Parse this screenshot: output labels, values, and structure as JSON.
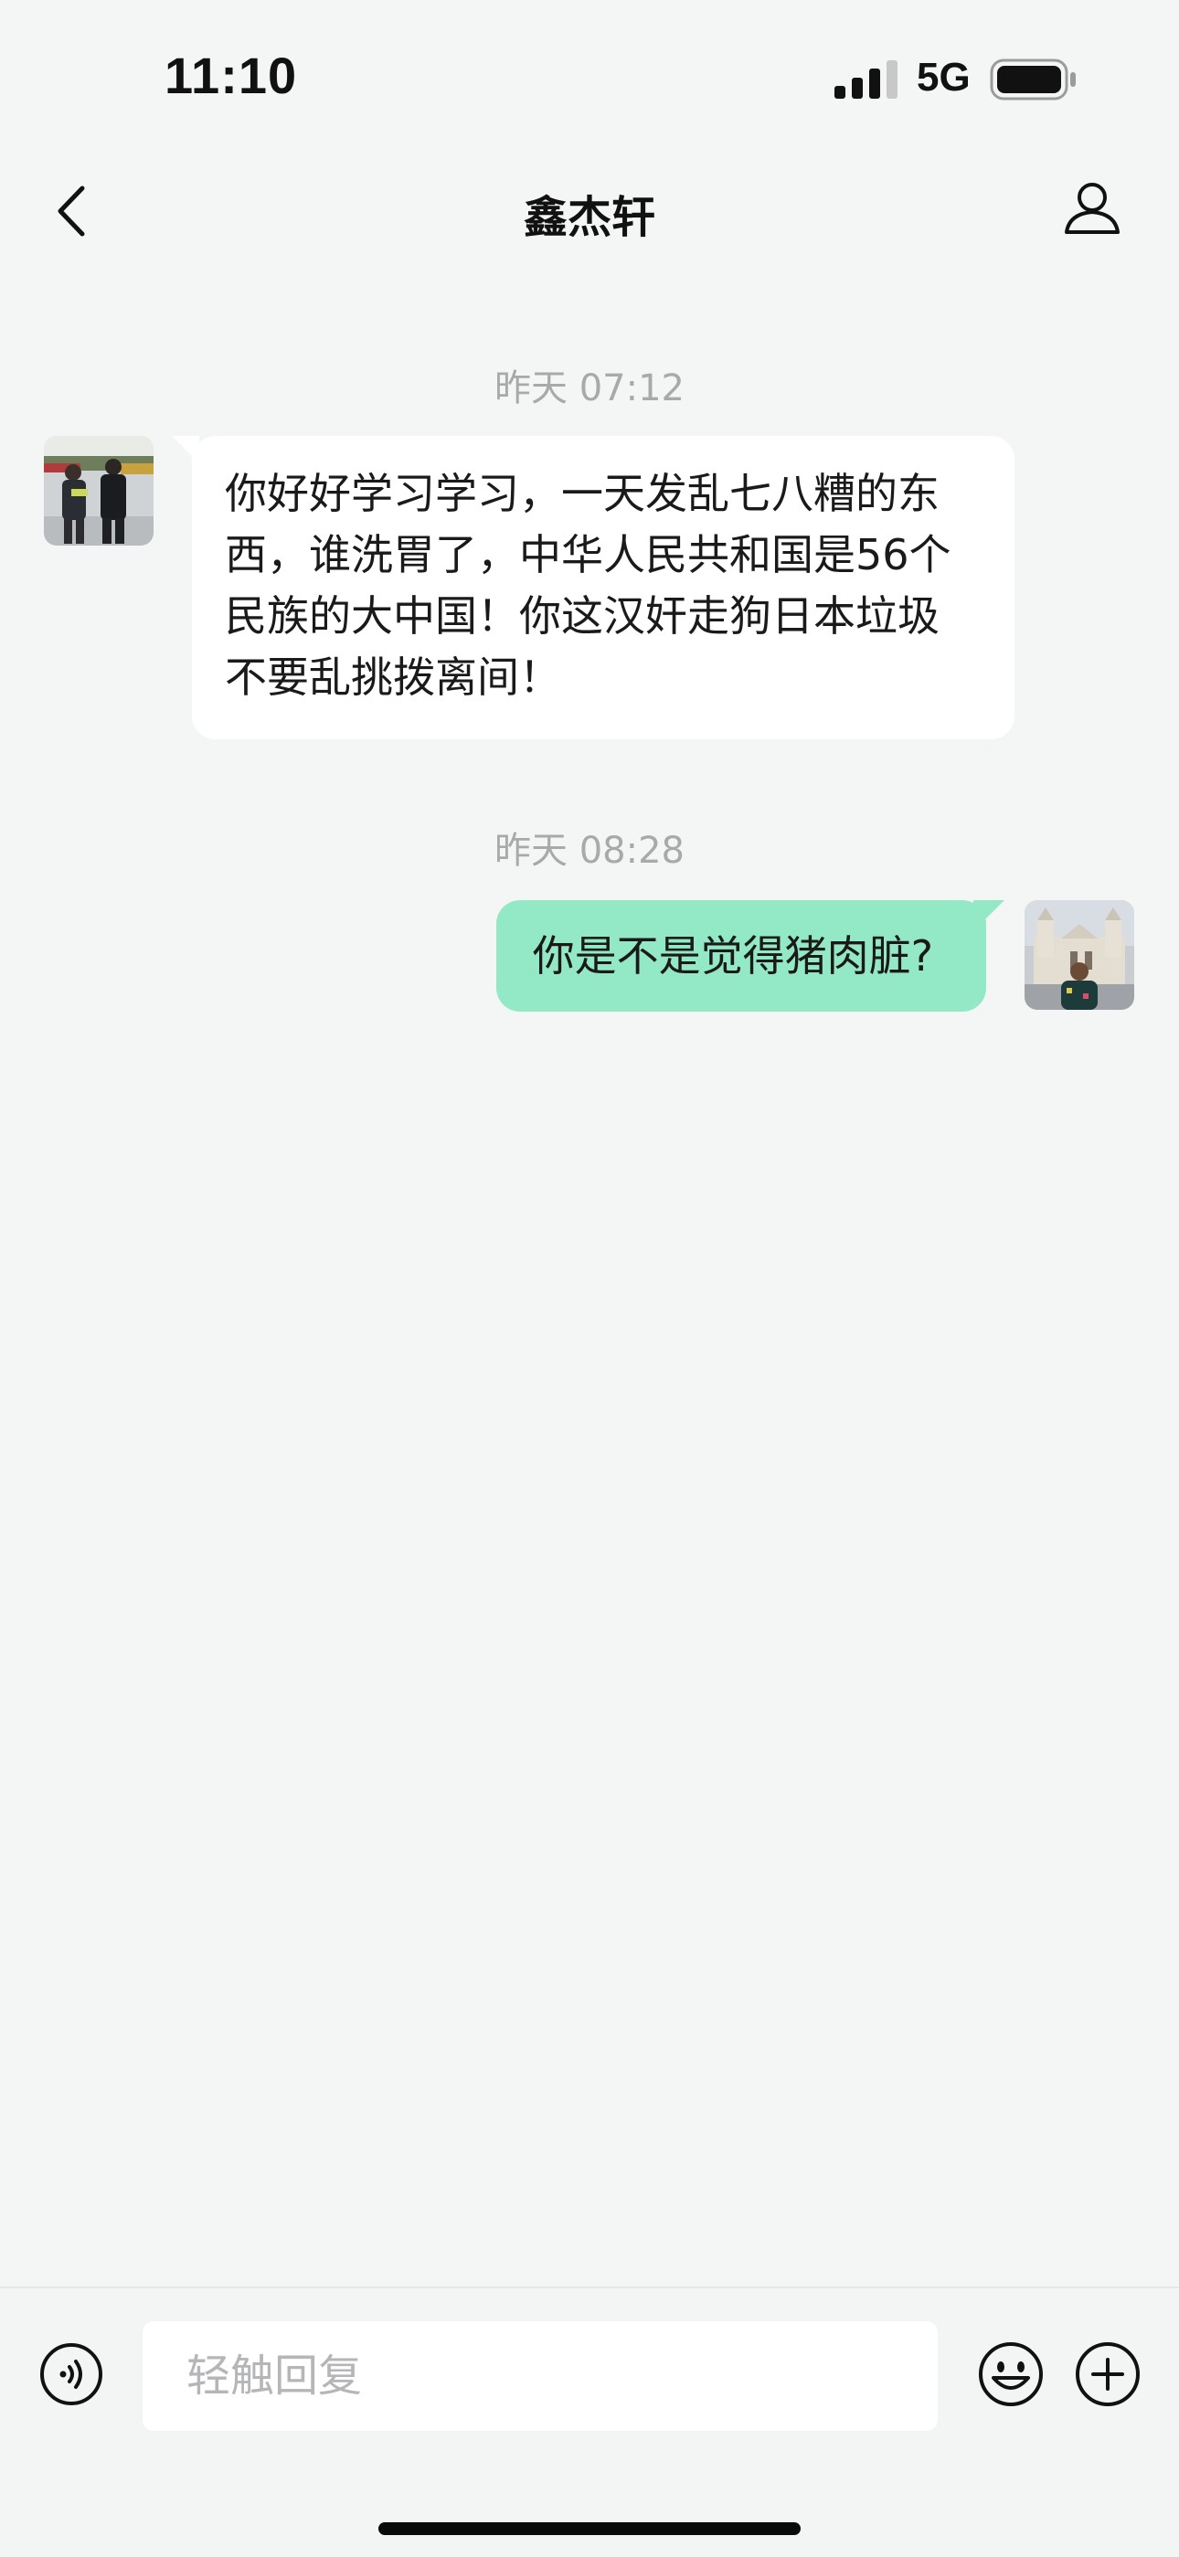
{
  "status_bar": {
    "time": "11:10",
    "network": "5G"
  },
  "nav": {
    "title": "鑫杰轩"
  },
  "messages": [
    {
      "timestamp": "昨天 07:12",
      "direction": "incoming",
      "text": "你好好学习学习，一天发乱七八糟的东西，谁洗胃了，中华人民共和国是56个民族的大中国！你这汉奸走狗日本垃圾不要乱挑拨离间！"
    },
    {
      "timestamp": "昨天 08:28",
      "direction": "outgoing",
      "text": "你是不是觉得猪肉脏?"
    }
  ],
  "input_bar": {
    "placeholder": "轻触回复"
  },
  "icons": {
    "back": "chevron-left-icon",
    "profile": "user-profile-icon",
    "voice": "voice-icon",
    "emoji": "emoji-icon",
    "plus": "plus-icon"
  },
  "colors": {
    "background": "#f4f6f5",
    "incoming_bubble": "#ffffff",
    "outgoing_bubble": "#93e9c6",
    "timestamp": "#a7a9ab"
  }
}
